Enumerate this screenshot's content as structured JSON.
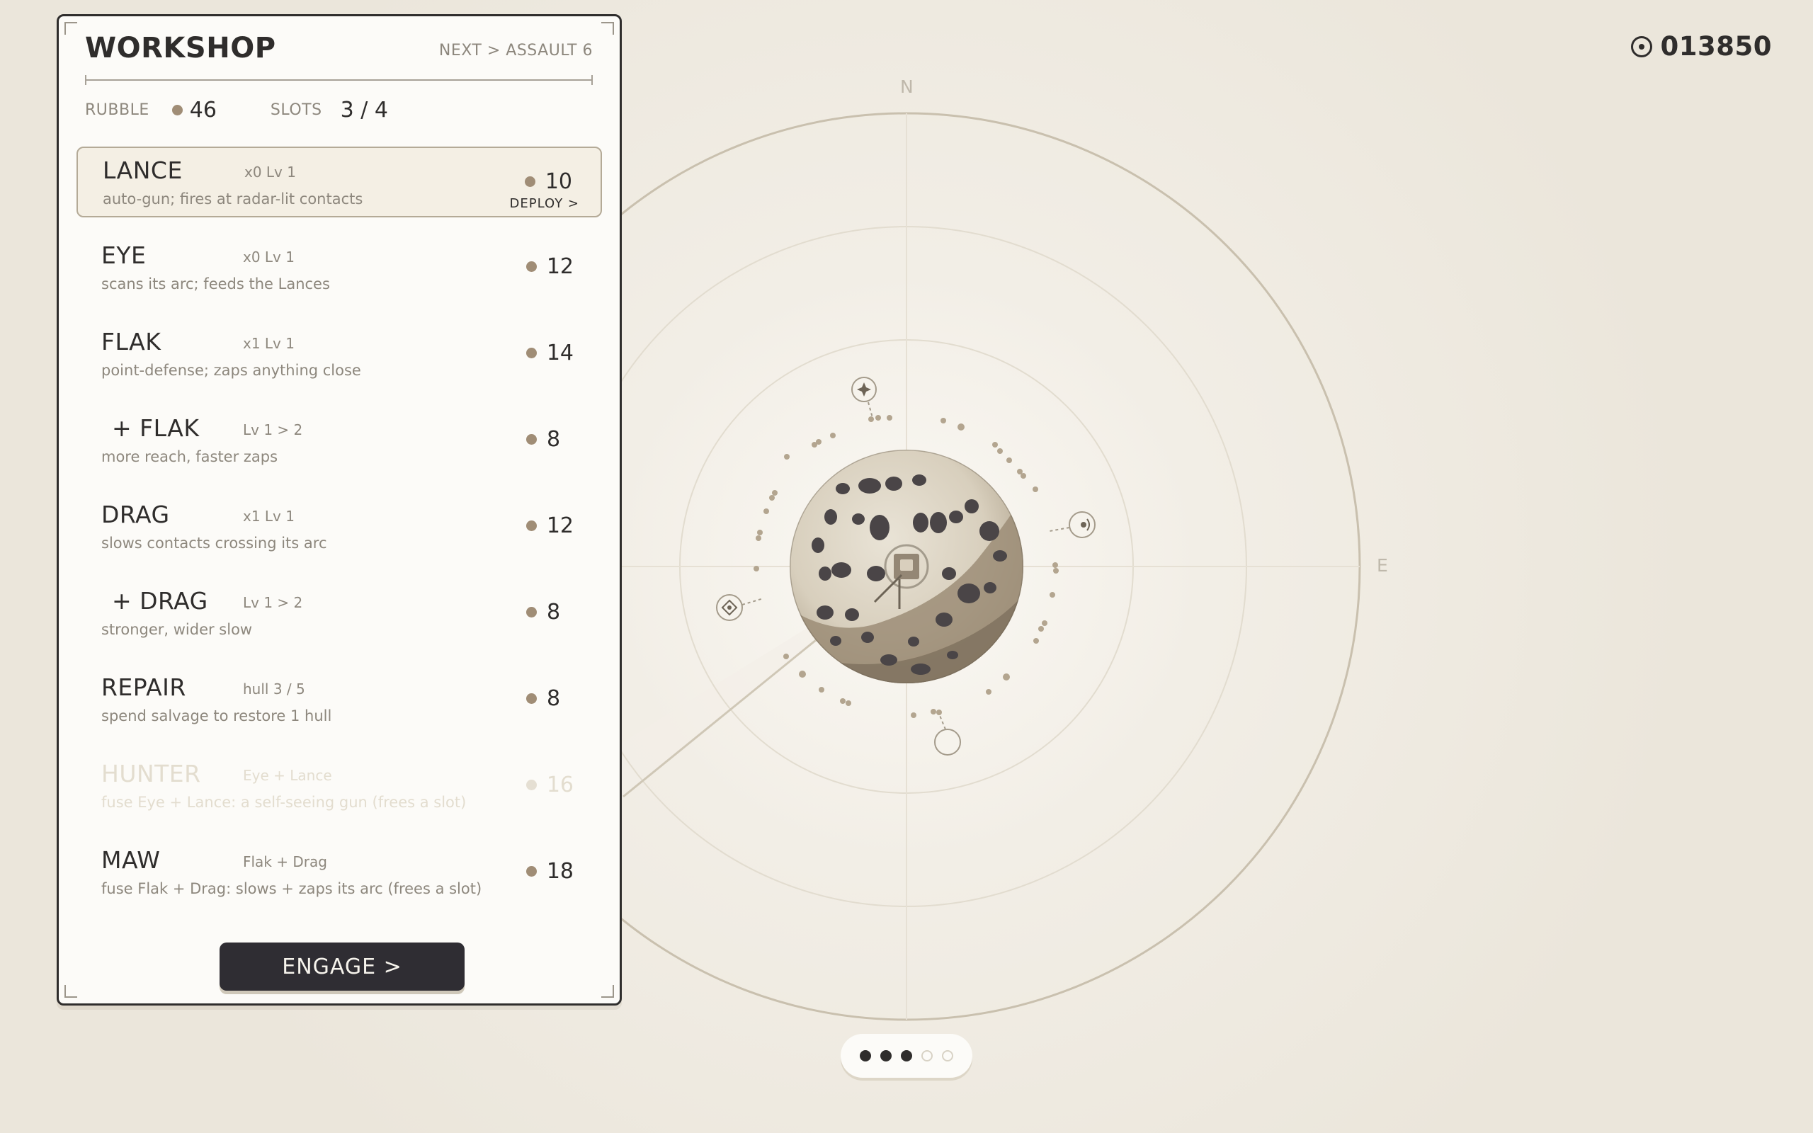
{
  "score": {
    "value": "013850",
    "icon": "target-icon"
  },
  "compass": {
    "north": "N",
    "east": "E"
  },
  "workshop": {
    "title": "WORKSHOP",
    "next_wave": "NEXT > ASSAULT 6",
    "rubble_label": "RUBBLE",
    "rubble_value": "46",
    "slots_label": "SLOTS",
    "slots_value": "3 / 4",
    "items": [
      {
        "name": "LANCE",
        "tag": "x0  Lv 1",
        "desc": "auto-gun; fires at radar-lit contacts",
        "cost": "10",
        "deploy": "DEPLOY >",
        "state": "selected"
      },
      {
        "name": "EYE",
        "tag": "x0  Lv 1",
        "desc": "scans its arc; feeds the Lances",
        "cost": "12",
        "state": "normal"
      },
      {
        "name": "FLAK",
        "tag": "x1  Lv 1",
        "desc": "point-defense; zaps anything close",
        "cost": "14",
        "state": "normal"
      },
      {
        "name": "+ FLAK",
        "tag": "Lv 1 > 2",
        "desc": "more reach, faster zaps",
        "cost": "8",
        "state": "upgrade"
      },
      {
        "name": "DRAG",
        "tag": "x1  Lv 1",
        "desc": "slows contacts crossing its arc",
        "cost": "12",
        "state": "normal"
      },
      {
        "name": "+ DRAG",
        "tag": "Lv 1 > 2",
        "desc": "stronger, wider slow",
        "cost": "8",
        "state": "upgrade"
      },
      {
        "name": "REPAIR",
        "tag": "hull 3 / 5",
        "desc": "spend salvage to restore 1 hull",
        "cost": "8",
        "state": "normal"
      },
      {
        "name": "HUNTER",
        "tag": "Eye + Lance",
        "desc": "fuse Eye + Lance: a self-seeing gun (frees a slot)",
        "cost": "16",
        "state": "locked"
      },
      {
        "name": "MAW",
        "tag": "Flak + Drag",
        "desc": "fuse Flak + Drag: slows + zaps its arc (frees a slot)",
        "cost": "18",
        "state": "normal"
      }
    ],
    "engage_label": "ENGAGE  >"
  },
  "pager": {
    "total": 5,
    "filled": 3
  },
  "colors": {
    "background": "#ede8de",
    "panel": "#fcfbf8",
    "ink": "#2f2d2c",
    "muted": "#8d877d",
    "rubble_dot": "#a08d76",
    "radar_line": "#c9c0ae",
    "button": "#2f2d33"
  }
}
